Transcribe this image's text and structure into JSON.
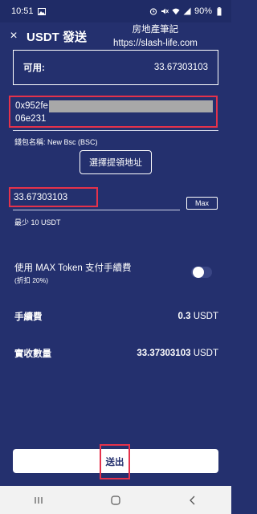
{
  "status_bar": {
    "time": "10:51",
    "battery": "90%"
  },
  "header": {
    "close_icon": "×",
    "title": "USDT 發送"
  },
  "watermark": {
    "line1": "房地產筆記",
    "line2": "https://slash-life.com"
  },
  "available": {
    "label": "可用:",
    "value": "33.67303103"
  },
  "address": {
    "line1": "0x952fe",
    "line2": "06e231"
  },
  "network": {
    "label": "錢包名稱: New Bsc (BSC)"
  },
  "select_address_button": "選擇提領地址",
  "amount": {
    "value": "33.67303103",
    "max_label": "Max",
    "min_label": "最少 10 USDT"
  },
  "max_token": {
    "label": "使用 MAX Token 支付手續費",
    "sub": "(折扣 20%)",
    "enabled": false
  },
  "fee": {
    "label": "手續費",
    "value": "0.3",
    "unit": "USDT"
  },
  "received": {
    "label": "實收數量",
    "value": "33.37303103",
    "unit": "USDT"
  },
  "submit_button": "送出",
  "colors": {
    "background": "#24306e",
    "highlight": "#e5324b"
  }
}
